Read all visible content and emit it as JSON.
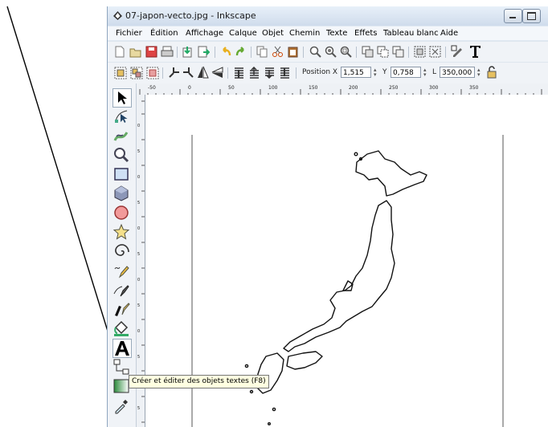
{
  "window": {
    "title": "07-japon-vecto.jpg - Inkscape"
  },
  "menu": [
    "Fichier",
    "Édition",
    "Affichage",
    "Calque",
    "Objet",
    "Chemin",
    "Texte",
    "Effets",
    "Tableau blanc",
    "Aide"
  ],
  "toolbar2": {
    "position_x_label": "Position X",
    "x_value": "1,515",
    "y_label": "Y",
    "y_value": "0,758",
    "l_label": "L",
    "l_value": "350,000"
  },
  "ruler_top": {
    "ticks": [
      "-50",
      "0",
      "50",
      "100",
      "150",
      "200",
      "250",
      "300",
      "350"
    ]
  },
  "ruler_left": {
    "ticks": [
      "0",
      "5",
      "0",
      "5",
      "0",
      "5",
      "0",
      "5",
      "0",
      "5",
      "0",
      "5"
    ]
  },
  "tooltip": {
    "text": "Créer et éditer des objets textes (F8)"
  },
  "colors": {
    "arrow": "#000000",
    "tooltip_bg": "#ffffe1",
    "titlebar": "#cfdcec"
  }
}
